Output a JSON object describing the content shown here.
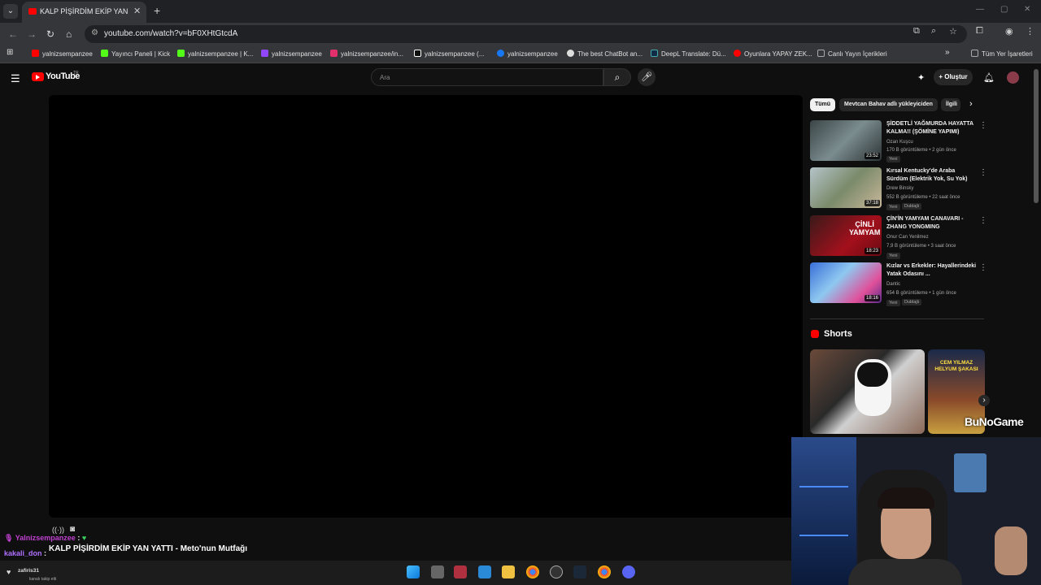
{
  "browser": {
    "tab_title": "KALP PİŞİRDİM EKİP YAN YATTI",
    "url": "youtube.com/watch?v=bF0XHtGtcdA",
    "bookmarks": [
      {
        "label": "yalnizsempanzee",
        "color": "#ff0000"
      },
      {
        "label": "Yayıncı Paneli | Kick",
        "color": "#53fc18"
      },
      {
        "label": "yalnizsempanzee | K...",
        "color": "#53fc18"
      },
      {
        "label": "yalnizsempanzee",
        "color": "#9146ff"
      },
      {
        "label": "yalnizsempanzee/in...",
        "color": "#e1306c"
      },
      {
        "label": "yalnizsempanzee (...",
        "color": "#ffffff"
      },
      {
        "label": "yalnizsempanzee",
        "color": "#1877f2"
      },
      {
        "label": "The best ChatBot an...",
        "color": "#dddddd"
      },
      {
        "label": "DeepL Translate: Dü...",
        "color": "#0f2b46"
      },
      {
        "label": "Oyunlara YAPAY ZEK...",
        "color": "#ff0000"
      },
      {
        "label": "Canlı Yayın İçerikleri",
        "color": "#aaaaaa"
      }
    ],
    "all_bookmarks": "Tüm Yer İşaretleri"
  },
  "youtube": {
    "logo_text": "YouTube",
    "logo_country": "TR",
    "search_placeholder": "Ara",
    "create_label": "Oluştur",
    "video_title": "KALP PİŞİRDİM EKİP YAN YATTI - Meto'nun Mutfağı",
    "chips": [
      "Tümü",
      "Mevtcan Bahav adlı yükleyiciden",
      "İlgili"
    ],
    "recommendations": [
      {
        "title": "ŞİDDETLİ YAĞMURDA HAYATTA KALMA!! (ŞÖMİNE YAPIMI)",
        "channel": "Ozan Kuşcu",
        "meta": "170 B görüntüleme • 2 gün önce",
        "badge": "Yeni",
        "badge2": "",
        "duration": "23:52",
        "thumb_color": "#5d6b6e"
      },
      {
        "title": "Kırsal Kentucky'de Araba Sürdüm (Elektrik Yok, Su Yok)",
        "channel": "Drew Binsky",
        "meta": "552 B görüntüleme • 22 saat önce",
        "badge": "Yeni",
        "badge2": "Dublajlı",
        "duration": "37:18",
        "thumb_color": "#7a8a6a"
      },
      {
        "title": "ÇİN'İN YAMYAM CANAVARI - ZHANG YONGMING",
        "channel": "Onur Can Yenilmez",
        "meta": "7,9 B görüntüleme • 3 saat önce",
        "badge": "Yeni",
        "badge2": "",
        "duration": "18:23",
        "thumb_color": "#a3101c"
      },
      {
        "title": "Kızlar vs Erkekler: Hayallerindeki Yatak Odasını ...",
        "channel": "Dantic",
        "meta": "654 B görüntüleme • 1 gün önce",
        "badge": "Yeni",
        "badge2": "Dublajlı",
        "duration": "18:16",
        "thumb_color": "#3a6fd8"
      }
    ],
    "shorts_label": "Shorts",
    "short_overlay": "CEM YILMAZ HELYUM ŞAKASI"
  },
  "overlay": {
    "watermark": "BuNoGame",
    "chat": [
      {
        "user": "Yalnizsempanzee",
        "color": "#c040d0",
        "text": ":"
      },
      {
        "user": "kakali_don",
        "color": "#b070ff",
        "text": ":"
      }
    ],
    "notification_user": "zafiris31",
    "notification_text": "kanalı takip etti"
  }
}
